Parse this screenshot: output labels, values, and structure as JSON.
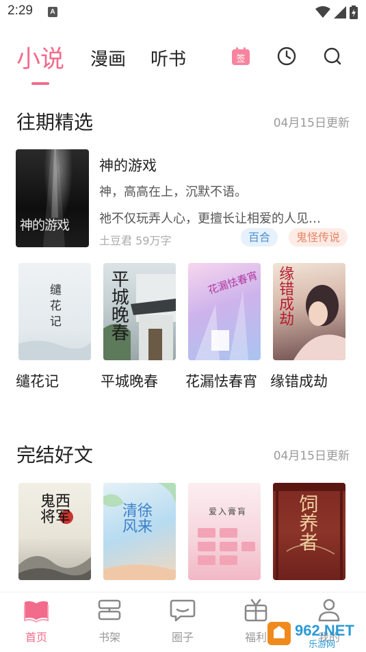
{
  "status_bar": {
    "time": "2:29",
    "indicator": "A"
  },
  "top_nav": {
    "tabs": [
      {
        "label": "小说"
      },
      {
        "label": "漫画"
      },
      {
        "label": "听书"
      }
    ],
    "signin_label": "签",
    "accent": "#f26b8b"
  },
  "sections": [
    {
      "title": "往期精选",
      "update": "04月15日更新",
      "featured": {
        "title": "神的游戏",
        "cover_title": "神的游戏",
        "line1": "神，高高在上，沉默不语。",
        "line2": "祂不仅玩弄人心，更擅长让相爱的人见…",
        "author": "土豆君 59万字",
        "tags": [
          "百合",
          "鬼怪传说"
        ]
      },
      "books": [
        {
          "name": "缱花记",
          "cover_text": "缱花记"
        },
        {
          "name": "平城晚春",
          "cover_text": "平城晚春"
        },
        {
          "name": "花漏怯春宵",
          "cover_text": "花漏怯春宵"
        },
        {
          "name": "缘错成劫",
          "cover_text": "缘错成劫"
        }
      ]
    },
    {
      "title": "完结好文",
      "update": "04月15日更新",
      "books": [
        {
          "cover_text": "鬼西将军"
        },
        {
          "cover_text": "清徐风来"
        },
        {
          "cover_text": "爱入膏肓"
        },
        {
          "cover_text": "饲养者"
        }
      ]
    }
  ],
  "bottom_nav": [
    {
      "label": "首页",
      "icon": "home-book-icon",
      "active": true
    },
    {
      "label": "书架",
      "icon": "bookshelf-icon",
      "active": false
    },
    {
      "label": "圈子",
      "icon": "chat-bubble-icon",
      "active": false
    },
    {
      "label": "福利",
      "icon": "gift-icon",
      "active": false
    },
    {
      "label": "我的",
      "icon": "user-icon",
      "active": false
    }
  ],
  "watermark": {
    "text": "962.NET",
    "subtext": "乐游网"
  }
}
